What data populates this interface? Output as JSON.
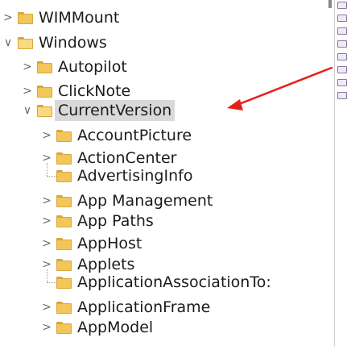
{
  "tree": {
    "items": [
      {
        "label": "WIMMount",
        "chevron": ">",
        "indent": 0
      },
      {
        "label": "Windows",
        "chevron": "v",
        "indent": 0
      },
      {
        "label": "Autopilot",
        "chevron": ">",
        "indent": 1
      },
      {
        "label": "ClickNote",
        "chevron": ">",
        "indent": 1
      },
      {
        "label": "CurrentVersion",
        "chevron": "v",
        "indent": 1,
        "selected": true
      },
      {
        "label": "AccountPicture",
        "chevron": ">",
        "indent": 2
      },
      {
        "label": "ActionCenter",
        "chevron": ">",
        "indent": 2
      },
      {
        "label": "AdvertisingInfo",
        "chevron": "",
        "indent": 2
      },
      {
        "label": "App Management",
        "chevron": ">",
        "indent": 2
      },
      {
        "label": "App Paths",
        "chevron": ">",
        "indent": 2
      },
      {
        "label": "AppHost",
        "chevron": ">",
        "indent": 2
      },
      {
        "label": "Applets",
        "chevron": ">",
        "indent": 2
      },
      {
        "label": "ApplicationAssociationTo:",
        "chevron": "",
        "indent": 2
      },
      {
        "label": "ApplicationFrame",
        "chevron": ">",
        "indent": 2
      },
      {
        "label": "AppModel",
        "chevron": ">",
        "indent": 2
      }
    ]
  },
  "annotation": {
    "type": "red-arrow",
    "points_to": "CurrentVersion",
    "color": "#e8201a"
  },
  "colors": {
    "selected_bg": "#d9d9d9",
    "folder": "#f2c659",
    "text": "#1b1b1b"
  }
}
